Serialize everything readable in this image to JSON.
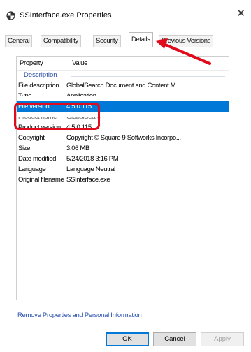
{
  "window": {
    "title": "SSInterface.exe Properties",
    "close_glyph": "✕"
  },
  "tabs": [
    {
      "label": "General"
    },
    {
      "label": "Compatibility"
    },
    {
      "label": "Security"
    },
    {
      "label": "Details",
      "active": true
    },
    {
      "label": "Previous Versions"
    }
  ],
  "table": {
    "columns": [
      "Property",
      "Value"
    ],
    "group": "Description",
    "rows": [
      {
        "property": "File description",
        "value": "GlobalSearch Document and Content M..."
      },
      {
        "property": "Type",
        "value": "Application"
      },
      {
        "property": "File version",
        "value": "4.5.0.115",
        "selected": true
      },
      {
        "property": "Product name",
        "value": "GlobalSearch"
      },
      {
        "property": "Product version",
        "value": "4.5.0.115"
      },
      {
        "property": "Copyright",
        "value": "Copyright © Square 9 Softworks Incorpo..."
      },
      {
        "property": "Size",
        "value": "3.06 MB"
      },
      {
        "property": "Date modified",
        "value": "5/24/2018 3:16 PM"
      },
      {
        "property": "Language",
        "value": "Language Neutral"
      },
      {
        "property": "Original filename",
        "value": "SSInterface.exe"
      }
    ]
  },
  "link": {
    "label": "Remove Properties and Personal Information"
  },
  "buttons": {
    "ok": "OK",
    "cancel": "Cancel",
    "apply": "Apply"
  },
  "annotation": {
    "color": "#e00b1c"
  }
}
